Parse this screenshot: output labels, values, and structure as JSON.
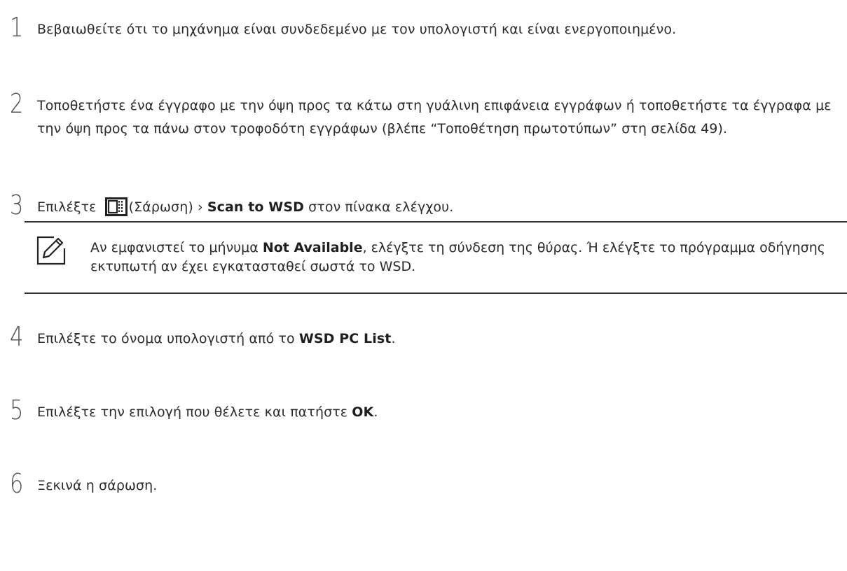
{
  "steps": [
    {
      "num": "1",
      "text": "Βεβαιωθείτε ότι το μηχάνημα είναι συνδεδεμένο με τον υπολογιστή και είναι ενεργοποιημένο."
    },
    {
      "num": "2",
      "text": "Τοποθετήστε ένα έγγραφο με την όψη προς τα κάτω στη γυάλινη επιφάνεια εγγράφων ή τοποθετήστε τα έγγραφα με την όψη προς τα πάνω στον τροφοδότη εγγράφων (βλέπε “Τοποθέτηση πρωτοτύπων” στη σελίδα 49)."
    },
    {
      "num": "3",
      "text_before": "Επιλέξτε",
      "icon_label": "(Σάρωση)",
      "separator": "›",
      "bold": "Scan to WSD",
      "text_after": "στον πίνακα ελέγχου."
    },
    {
      "num": "4",
      "text_before": "Επιλέξτε το όνομα υπολογιστή από το",
      "bold": "WSD PC List",
      "text_after": "."
    },
    {
      "num": "5",
      "text_before": "Επιλέξτε την επιλογή που θέλετε και πατήστε",
      "bold": "OK",
      "text_after": "."
    },
    {
      "num": "6",
      "text": "Ξεκινά η σάρωση."
    }
  ],
  "note": {
    "icon": "pencil-note-icon",
    "text_before": "Αν εμφανιστεί το μήνυμα",
    "bold": "Not Available",
    "text_after": ", ελέγξτε τη σύνδεση της θύρας. Ή ελέγξτε το πρόγραμμα οδήγησης εκτυπωτή αν έχει εγκατασταθεί σωστά το WSD."
  },
  "colors": {
    "text": "#2b2b2b",
    "rule": "#333333"
  }
}
